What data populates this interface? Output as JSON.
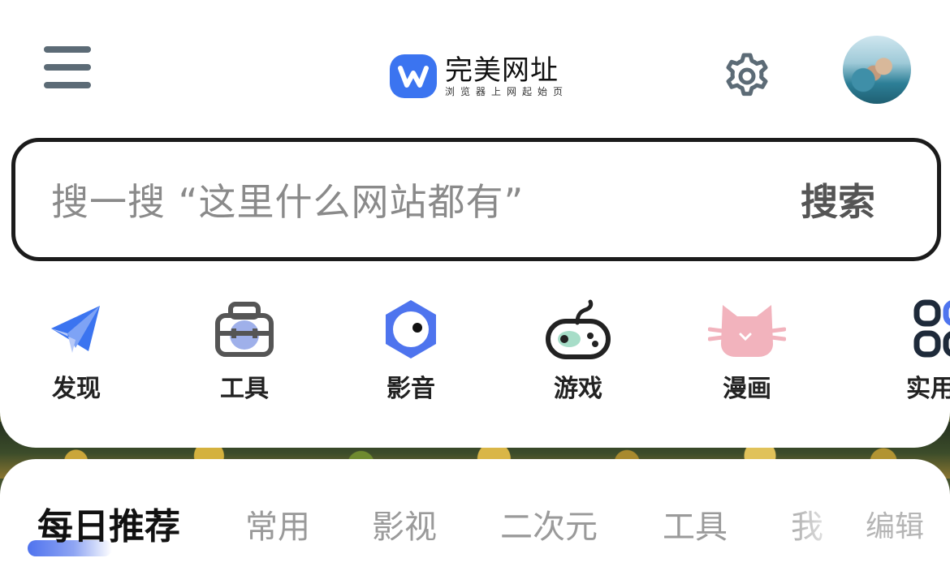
{
  "header": {
    "logo_title": "完美网址",
    "logo_subtitle": "浏览器上网起始页",
    "logo_icon": "w-logo-icon",
    "menu_icon": "menu-icon",
    "settings_icon": "gear-icon",
    "avatar": "user-avatar"
  },
  "search": {
    "placeholder": "搜一搜  “这里什么网站都有”",
    "button_label": "搜索"
  },
  "categories": [
    {
      "label": "发现",
      "icon": "paper-plane-icon"
    },
    {
      "label": "工具",
      "icon": "toolbox-icon"
    },
    {
      "label": "影音",
      "icon": "media-eye-icon"
    },
    {
      "label": "游戏",
      "icon": "gamepad-icon"
    },
    {
      "label": "漫画",
      "icon": "cat-icon"
    },
    {
      "label": "实用",
      "icon": "apps-grid-icon"
    }
  ],
  "tabs": [
    {
      "label": "每日推荐",
      "active": true
    },
    {
      "label": "常用",
      "active": false
    },
    {
      "label": "影视",
      "active": false
    },
    {
      "label": "二次元",
      "active": false
    },
    {
      "label": "工具",
      "active": false
    },
    {
      "label": "我",
      "active": false
    }
  ],
  "edit_label": "编辑",
  "colors": {
    "brand_blue": "#3b74f0",
    "pink": "#f2b3bd",
    "icon_gray": "#5c6b76"
  }
}
